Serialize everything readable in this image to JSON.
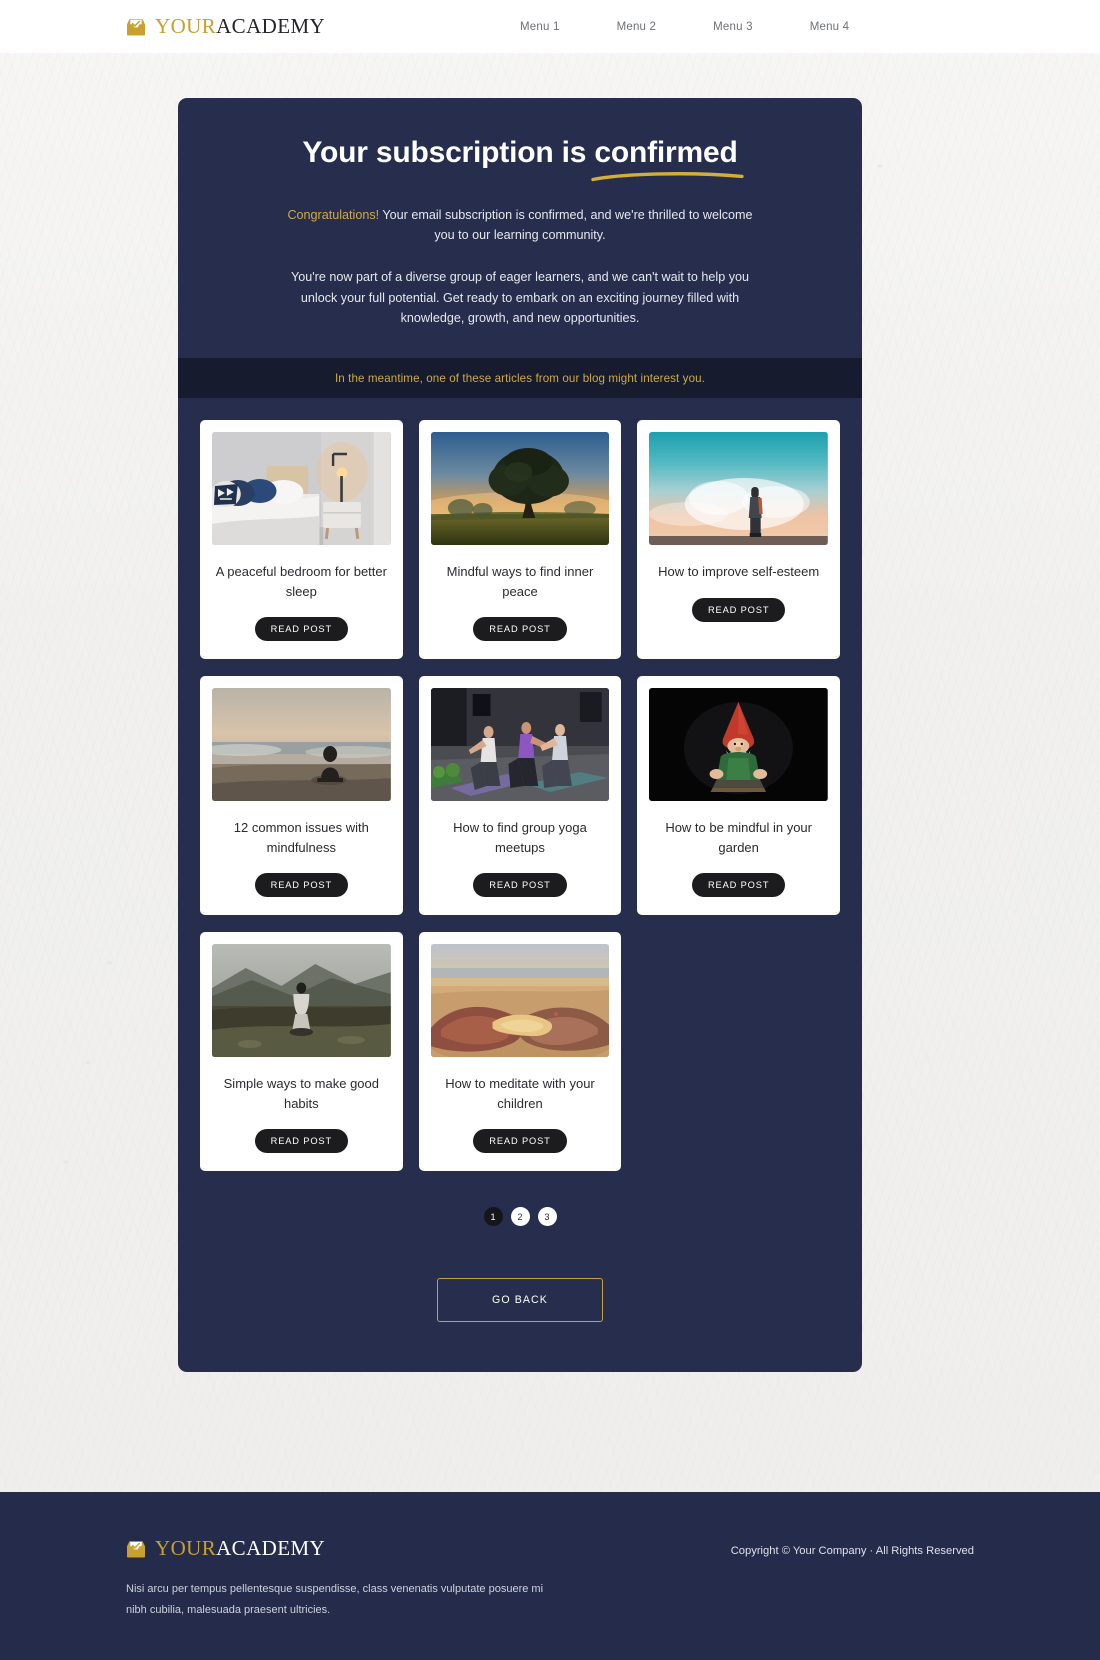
{
  "header": {
    "logo": {
      "icon": "inbox-envelope-icon",
      "word_primary": "YOUR",
      "word_secondary": "ACADEMY"
    },
    "nav": [
      {
        "label": "Menu 1"
      },
      {
        "label": "Menu 2"
      },
      {
        "label": "Menu 3"
      },
      {
        "label": "Menu 4"
      }
    ]
  },
  "hero": {
    "headline_lead": "Your subscription is ",
    "headline_emphasis": "confirmed",
    "congrats": "Congratulations!",
    "paragraph_1": " Your email subscription is confirmed, and we're thrilled to welcome you to our learning community.",
    "paragraph_2": "You're now part of a diverse group of eager learners, and we can't wait to help you unlock your full potential. Get ready to embark on an exciting journey filled with knowledge, growth, and new opportunities.",
    "strip_text": "In the meantime, one of these articles from our blog might interest you."
  },
  "articles": [
    {
      "title": "A peaceful bedroom for better sleep",
      "button": "READ POST",
      "image": "bedroom-photo"
    },
    {
      "title": "Mindful ways to find inner peace",
      "button": "READ POST",
      "image": "tree-field-sunrise-photo"
    },
    {
      "title": "How to improve self-esteem",
      "button": "READ POST",
      "image": "person-standing-sky-photo"
    },
    {
      "title": "12 common issues with mindfulness",
      "button": "READ POST",
      "image": "person-sitting-beach-photo"
    },
    {
      "title": "How to find group yoga meetups",
      "button": "READ POST",
      "image": "yoga-class-photo"
    },
    {
      "title": "How to be mindful in your garden",
      "button": "READ POST",
      "image": "garden-gnome-meditating-photo"
    },
    {
      "title": "Simple ways to make good habits",
      "button": "READ POST",
      "image": "person-on-mountain-photo"
    },
    {
      "title": "How to meditate with your children",
      "button": "READ POST",
      "image": "hands-on-beach-photo"
    }
  ],
  "pagination": {
    "pages": [
      {
        "label": "1",
        "active": true
      },
      {
        "label": "2",
        "active": false
      },
      {
        "label": "3",
        "active": false
      }
    ]
  },
  "actions": {
    "go_back": "GO BACK"
  },
  "footer": {
    "logo": {
      "icon": "inbox-envelope-icon",
      "word_primary": "YOUR",
      "word_secondary": "ACADEMY"
    },
    "copyright": "Copyright © Your Company · All Rights Reserved",
    "description": "Nisi arcu per tempus pellentesque suspendisse, class venenatis vulputate posuere mi nibh cubilia, malesuada praesent ultricies."
  },
  "colors": {
    "panel_navy": "#262d4d",
    "strip_dark": "#161b2d",
    "gold": "#c8a02e",
    "gold_text": "#d2a93f",
    "button_dark": "#1c1c1e",
    "page_bg": "#f2f1ef"
  }
}
